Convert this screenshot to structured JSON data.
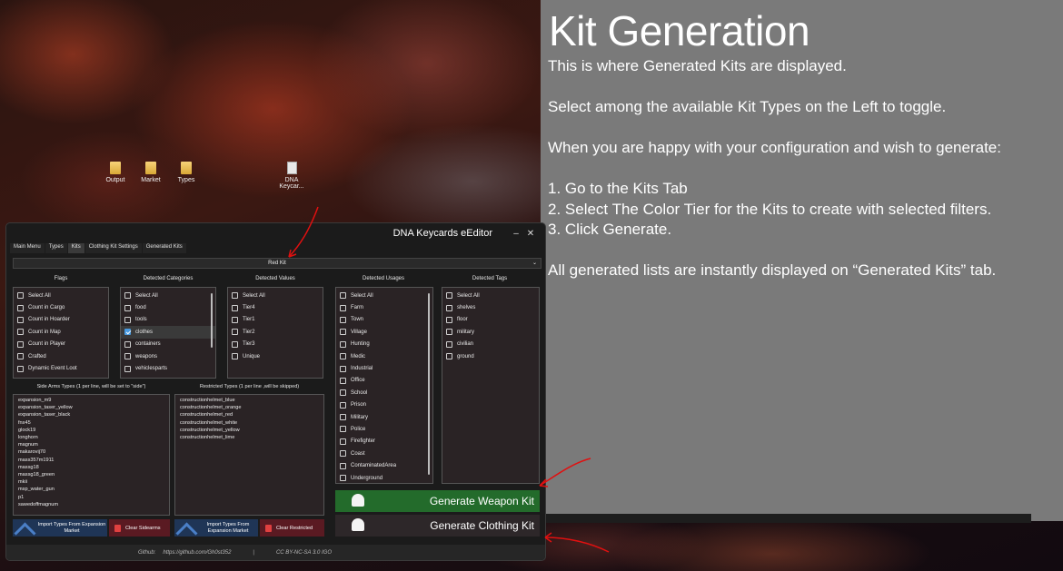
{
  "desktop": {
    "icons": [
      {
        "label": "Output",
        "kind": "folder"
      },
      {
        "label": "Market",
        "kind": "folder"
      },
      {
        "label": "Types",
        "kind": "folder"
      },
      {
        "label": "DNA Keycar...",
        "kind": "file"
      }
    ]
  },
  "panel": {
    "title": "Kit Generation",
    "line1": "This is where Generated Kits are displayed.",
    "line2": "Select among the available Kit Types on the Left to toggle.",
    "line3": "When you are happy with your configuration and wish to generate:",
    "step1": "1. Go to the Kits Tab",
    "step2": "2. Select The Color Tier for the Kits to create with selected filters.",
    "step3": "3. Click Generate.",
    "line4": "All generated lists are instantly displayed on “Generated Kits” tab."
  },
  "window": {
    "title": "DNA Keycards eEditor",
    "minimize": "–",
    "close": "✕",
    "tabs": [
      "Main Menu",
      "Types",
      "Kits",
      "Clothing Kit Settings",
      "Generated Kits"
    ],
    "active_tab": "Kits",
    "kit_select": "Red Kit",
    "columns": {
      "flags": {
        "header": "Flags",
        "items": [
          {
            "label": "Select All",
            "checked": false
          },
          {
            "label": "Count in Cargo",
            "checked": false
          },
          {
            "label": "Count in Hoarder",
            "checked": false
          },
          {
            "label": "Count in Map",
            "checked": false
          },
          {
            "label": "Count in Player",
            "checked": false
          },
          {
            "label": "Crafted",
            "checked": false
          },
          {
            "label": "Dynamic Event Loot",
            "checked": false
          }
        ]
      },
      "categories": {
        "header": "Detected Categories",
        "items": [
          {
            "label": "Select All",
            "checked": false
          },
          {
            "label": "food",
            "checked": false
          },
          {
            "label": "tools",
            "checked": false
          },
          {
            "label": "clothes",
            "checked": true
          },
          {
            "label": "containers",
            "checked": false
          },
          {
            "label": "weapons",
            "checked": false
          },
          {
            "label": "vehiclesparts",
            "checked": false
          }
        ]
      },
      "values": {
        "header": "Detected Values",
        "items": [
          {
            "label": "Select All",
            "checked": false
          },
          {
            "label": "Tier4",
            "checked": false
          },
          {
            "label": "Tier1",
            "checked": false
          },
          {
            "label": "Tier2",
            "checked": false
          },
          {
            "label": "Tier3",
            "checked": false
          },
          {
            "label": "Unique",
            "checked": false
          }
        ]
      },
      "usages": {
        "header": "Detected Usages",
        "items": [
          {
            "label": "Select All",
            "checked": false
          },
          {
            "label": "Farm",
            "checked": false
          },
          {
            "label": "Town",
            "checked": false
          },
          {
            "label": "Village",
            "checked": false
          },
          {
            "label": "Hunting",
            "checked": false
          },
          {
            "label": "Medic",
            "checked": false
          },
          {
            "label": "Industrial",
            "checked": false
          },
          {
            "label": "Office",
            "checked": false
          },
          {
            "label": "School",
            "checked": false
          },
          {
            "label": "Prison",
            "checked": false
          },
          {
            "label": "Military",
            "checked": false
          },
          {
            "label": "Police",
            "checked": false
          },
          {
            "label": "Firefighter",
            "checked": false
          },
          {
            "label": "Coast",
            "checked": false
          },
          {
            "label": "ContaminatedArea",
            "checked": false
          },
          {
            "label": "Underground",
            "checked": false
          }
        ]
      },
      "tags": {
        "header": "Detected Tags",
        "items": [
          {
            "label": "Select All",
            "checked": false
          },
          {
            "label": "shelves",
            "checked": false
          },
          {
            "label": "floor",
            "checked": false
          },
          {
            "label": "military",
            "checked": false
          },
          {
            "label": "civilian",
            "checked": false
          },
          {
            "label": "ground",
            "checked": false
          }
        ]
      }
    },
    "sidearms": {
      "label": "Side Arms Types (1 per line, will be set to \"side\")",
      "items": [
        "expansion_m9",
        "expansion_taser_yellow",
        "expansion_taser_black",
        "fnx45",
        "glock19",
        "longhorn",
        "magnum",
        "makarovij70",
        "mass357m1911",
        "massg18",
        "massg18_green",
        "mkii",
        "msp_water_gun",
        "p1",
        "sawedoffmagnum"
      ]
    },
    "restricted": {
      "label": "Restricted Types (1 per line ,will be skipped)",
      "items": [
        "constructionhelmet_blue",
        "constructionhelmet_orange",
        "constructionhelmet_red",
        "constructionhelmet_white",
        "constructionhelmet_yellow",
        "constructionhelmet_lime"
      ]
    },
    "buttons": {
      "import_sidearms": "Import Types From Expansion Market",
      "clear_sidearms": "Clear Sidearms",
      "import_restricted": "Import Types From Expansion Market",
      "clear_restricted": "Clear Restricted",
      "generate_weapon": "Generate Weapon Kit",
      "generate_clothing": "Generate Clothing Kit"
    },
    "footer": {
      "github_label": "Github:",
      "github_url": "https://github.com/Gh0st352",
      "separator": "|",
      "license": "CC BY-NC-SA 3.0 IGO"
    }
  },
  "colors": {
    "panel_bg": "#7a7a7a",
    "window_bg": "#1b1b1b",
    "weapon_button": "#236b2b",
    "annotation_arrow": "#e01010",
    "checkbox_checked": "#4a9ae0"
  }
}
